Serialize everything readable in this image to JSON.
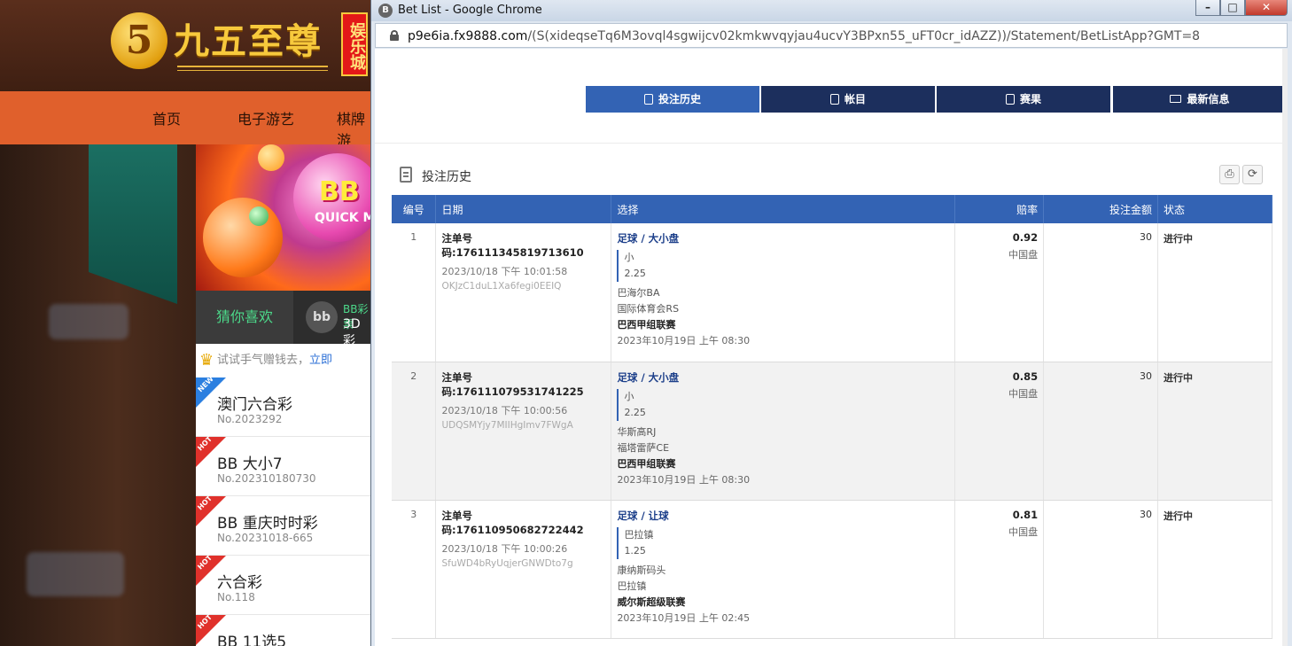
{
  "site": {
    "logo_digit": "5",
    "logo_text": "九五至尊",
    "logo_badge": "娱乐城",
    "nav": [
      "首页",
      "电子游艺",
      "棋牌游"
    ],
    "banner": {
      "bb_logo": "BB",
      "bb_sub": "QUICK MARK"
    },
    "tabs": {
      "guess": "猜你喜欢",
      "bb_icon": "bb",
      "bb_title": "BB彩票",
      "bb_sub": "3D彩"
    },
    "promo": {
      "text": "试试手气赠钱去，",
      "link": "立即"
    },
    "lotteries": [
      {
        "badge": "NEW",
        "name": "澳门六合彩",
        "no": "No.2023292"
      },
      {
        "badge": "HOT",
        "name": "BB 大小7",
        "no": "No.202310180730"
      },
      {
        "badge": "HOT",
        "name": "BB 重庆时时彩",
        "no": "No.20231018-665"
      },
      {
        "badge": "HOT",
        "name": "六合彩",
        "no": "No.118"
      },
      {
        "badge": "HOT",
        "name": "BB 11选5",
        "no": ""
      }
    ]
  },
  "window": {
    "title": "Bet List - Google Chrome",
    "url_host": "p9e6ia.fx9888.com",
    "url_path": "/(S(xideqseTq6M3ovql4sgwijcv02kmkwvqyjau4ucvY3BPxn55_uFT0cr_idAZZ))/Statement/BetListApp?GMT=8",
    "controls": {
      "min": "–",
      "max": "□",
      "close": "✕"
    }
  },
  "topnav": {
    "items": [
      {
        "label": "投注历史",
        "active": true,
        "icon": "clipboard-icon"
      },
      {
        "label": "帐目",
        "active": false,
        "icon": "ledger-icon"
      },
      {
        "label": "赛果",
        "active": false,
        "icon": "results-icon"
      },
      {
        "label": "最新信息",
        "active": false,
        "icon": "mail-icon"
      }
    ]
  },
  "section": {
    "title": "投注历史",
    "print": "⎙",
    "refresh": "⟳"
  },
  "table": {
    "headers": {
      "no": "编号",
      "date": "日期",
      "selection": "选择",
      "odds": "赔率",
      "stake": "投注金额",
      "status": "状态"
    },
    "rows": [
      {
        "no": "1",
        "ticket": "注单号码:176111345819713610",
        "date": "2023/10/18 下午 10:01:58",
        "code": "OKJzC1duL1Xa6fegi0EEIQ",
        "sport": "足球 / 大小盘",
        "pick": "小",
        "line": "2.25",
        "home": "巴海尔BA",
        "away": "国际体育会RS",
        "league": "巴西甲组联赛",
        "kickoff": "2023年10月19日 上午 08:30",
        "odds": "0.92",
        "market": "中国盘",
        "stake": "30",
        "status": "进行中"
      },
      {
        "no": "2",
        "ticket": "注单号码:176111079531741225",
        "date": "2023/10/18 下午 10:00:56",
        "code": "UDQSMYjy7MIIHgImv7FWgA",
        "sport": "足球 / 大小盘",
        "pick": "小",
        "line": "2.25",
        "home": "华斯高RJ",
        "away": "福塔雷萨CE",
        "league": "巴西甲组联赛",
        "kickoff": "2023年10月19日 上午 08:30",
        "odds": "0.85",
        "market": "中国盘",
        "stake": "30",
        "status": "进行中"
      },
      {
        "no": "3",
        "ticket": "注单号码:176110950682722442",
        "date": "2023/10/18 下午 10:00:26",
        "code": "SfuWD4bRyUqjerGNWDto7g",
        "sport": "足球 / 让球",
        "pick": "巴拉镇",
        "line": "1.25",
        "home": "康纳斯码头",
        "away": "巴拉镇",
        "league": "威尔斯超级联赛",
        "kickoff": "2023年10月19日 上午 02:45",
        "odds": "0.81",
        "market": "中国盘",
        "stake": "30",
        "status": "进行中"
      }
    ]
  }
}
